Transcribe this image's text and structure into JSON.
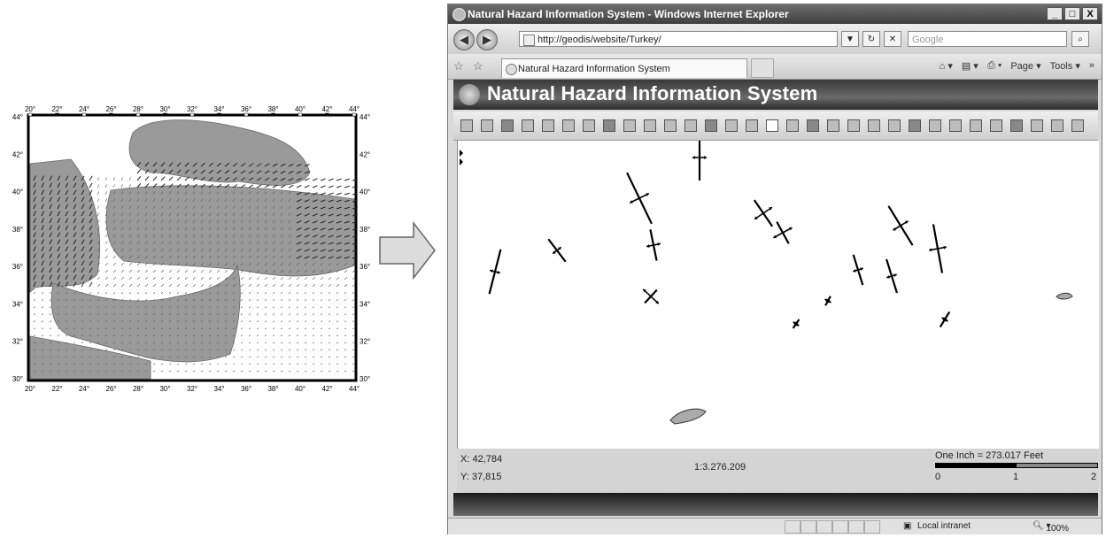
{
  "left_map": {
    "lon_ticks": [
      "20°",
      "22°",
      "24°",
      "26°",
      "28°",
      "30°",
      "32°",
      "34°",
      "36°",
      "38°",
      "40°",
      "42°",
      "44°"
    ],
    "lat_ticks": [
      "30°",
      "32°",
      "34°",
      "36°",
      "38°",
      "40°",
      "42°",
      "44°"
    ]
  },
  "window": {
    "title": "Natural Hazard Information System - Windows Internet Explorer",
    "minimize_icon": "_",
    "restore_icon": "□",
    "close_icon": "X"
  },
  "address": {
    "url": "http://geodis/website/Turkey/",
    "search_placeholder": "Google"
  },
  "tab": {
    "label": "Natural Hazard Information System"
  },
  "command_bar": {
    "page_label": "Page",
    "tools_label": "Tools"
  },
  "page": {
    "title": "Natural Hazard Information System"
  },
  "map_status": {
    "x_readout": "X: 42,784",
    "y_readout": "Y: 37,815",
    "scale": "1:3.276.209",
    "scale_caption": "One Inch = 273.017 Feet",
    "scale_marks": [
      "0",
      "1",
      "2"
    ]
  },
  "ie_status": {
    "zone": "Local intranet",
    "zoom": "100%"
  },
  "colors": {
    "land": "#9a9a9a",
    "titlebar": "#4a4a4a"
  }
}
